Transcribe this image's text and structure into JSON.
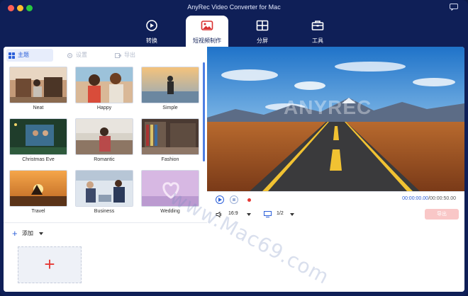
{
  "window": {
    "title": "AnyRec Video Converter for Mac"
  },
  "topnav": {
    "items": [
      {
        "label": "转换",
        "icon": "convert-icon",
        "active": false
      },
      {
        "label": "短视频制作",
        "icon": "mv-maker-icon",
        "active": true
      },
      {
        "label": "分屏",
        "icon": "split-screen-icon",
        "active": false
      },
      {
        "label": "工具",
        "icon": "toolbox-icon",
        "active": false
      }
    ]
  },
  "subtabs": {
    "theme": "主题",
    "settings": "设置",
    "export": "导出"
  },
  "themes": [
    {
      "label": "Neat"
    },
    {
      "label": "Happy"
    },
    {
      "label": "Simple"
    },
    {
      "label": "Christmas Eve"
    },
    {
      "label": "Romantic"
    },
    {
      "label": "Fashion"
    },
    {
      "label": "Travel"
    },
    {
      "label": "Business"
    },
    {
      "label": "Wedding"
    }
  ],
  "add": {
    "label": "添加"
  },
  "preview": {
    "watermark": "ANYREC"
  },
  "player": {
    "time_current": "00:00:00.00",
    "time_total": "/00:00:50.00",
    "aspect_ratio": "16:9",
    "page": "1/2",
    "export_label": "导出"
  },
  "watermark": "www.Mac69.com",
  "colors": {
    "accent": "#2b5fd9",
    "frame": "#0f1f57",
    "record": "#e53935",
    "export_disabled": "#f9c7c7"
  }
}
